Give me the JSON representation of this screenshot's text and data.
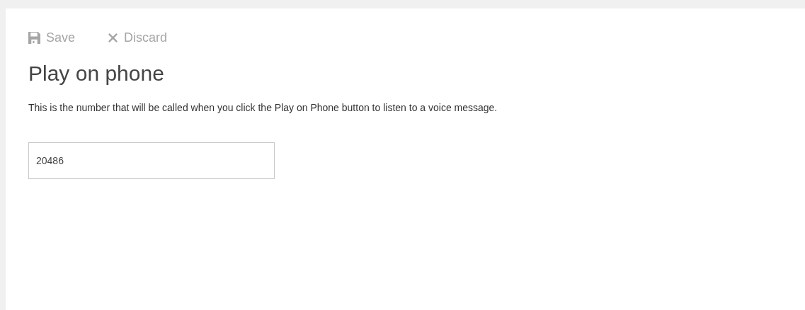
{
  "toolbar": [
    {
      "kind": "save",
      "label": "Save",
      "disabled": true
    },
    {
      "kind": "discard",
      "label": "Discard",
      "disabled": true
    }
  ],
  "title": "Play on phone",
  "description": "This is the number that will be called when you click the Play on Phone button to listen to a voice message.",
  "phone_field": {
    "value": "20486"
  }
}
